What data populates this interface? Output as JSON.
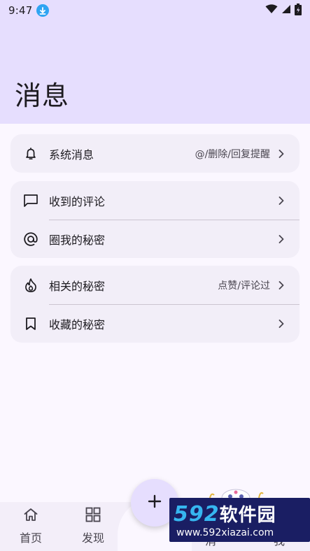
{
  "status_bar": {
    "time": "9:47",
    "icons": [
      "download-badge-icon",
      "wifi-icon",
      "signal-icon",
      "battery-charging-icon"
    ]
  },
  "header": {
    "title": "消息"
  },
  "cards": [
    {
      "items": [
        {
          "icon": "bell-icon",
          "label": "系统消息",
          "hint": "@/删除/回复提醒"
        }
      ]
    },
    {
      "items": [
        {
          "icon": "comment-icon",
          "label": "收到的评论",
          "hint": ""
        },
        {
          "icon": "at-sign-icon",
          "label": "圈我的秘密",
          "hint": ""
        }
      ]
    },
    {
      "items": [
        {
          "icon": "flame-icon",
          "label": "相关的秘密",
          "hint": "点赞/评论过"
        },
        {
          "icon": "bookmark-icon",
          "label": "收藏的秘密",
          "hint": ""
        }
      ]
    }
  ],
  "bottom_nav": {
    "home_label": "首页",
    "discover_label": "发现",
    "messages_label_partial": "消",
    "me_label_partial": "我"
  },
  "fab": {
    "icon": "plus-icon"
  },
  "watermark": {
    "brand_num": "592",
    "brand_cn": "软件园",
    "url": "www.592xiazai.com"
  },
  "colors": {
    "header_bg": "#e6defe",
    "page_bg": "#fbf7ff",
    "card_bg": "#f2eef8",
    "accent": "#e6defe"
  }
}
